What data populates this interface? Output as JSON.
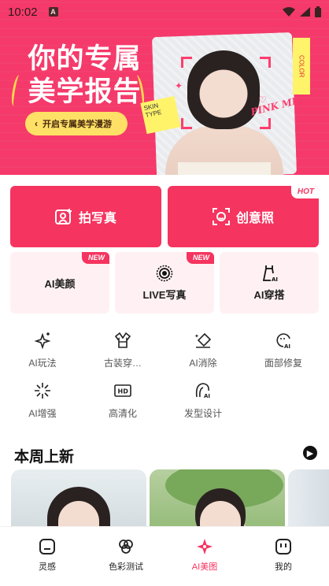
{
  "status_bar": {
    "time": "10:02"
  },
  "banner": {
    "title_line1": "你的专属",
    "title_line2": "美学报告",
    "cta": "开启专属美学漫游",
    "sticker_skin": "SKIN TYPE",
    "sticker_color": "COLOR",
    "sticker_pink": "PINK ME"
  },
  "primary_actions": [
    {
      "label": "拍写真"
    },
    {
      "label": "创意照",
      "badge": "HOT"
    }
  ],
  "feature_cards": [
    {
      "label": "AI美颜",
      "badge": "NEW"
    },
    {
      "label": "LIVE写真",
      "badge": "NEW"
    },
    {
      "label": "AI穿搭"
    }
  ],
  "tools": [
    {
      "label": "AI玩法",
      "icon": "sparkle-icon"
    },
    {
      "label": "古装穿…",
      "icon": "robe-icon"
    },
    {
      "label": "AI消除",
      "icon": "eraser-icon"
    },
    {
      "label": "面部修复",
      "icon": "face-repair-icon"
    },
    {
      "label": "AI增强",
      "icon": "enhance-icon"
    },
    {
      "label": "高清化",
      "icon": "hd-icon"
    },
    {
      "label": "发型设计",
      "icon": "hairstyle-icon"
    }
  ],
  "weekly": {
    "title": "本周上新"
  },
  "bottom_nav": [
    {
      "label": "灵感",
      "icon": "inspiration-icon",
      "active": false
    },
    {
      "label": "色彩测试",
      "icon": "color-test-icon",
      "active": false
    },
    {
      "label": "AI美图",
      "icon": "ai-beauty-icon",
      "active": true
    },
    {
      "label": "我的",
      "icon": "profile-icon",
      "active": false
    }
  ],
  "colors": {
    "accent": "#f5345f",
    "banner": "#f5396a",
    "cta": "#ffe066",
    "card_tint": "#fff1f3"
  }
}
